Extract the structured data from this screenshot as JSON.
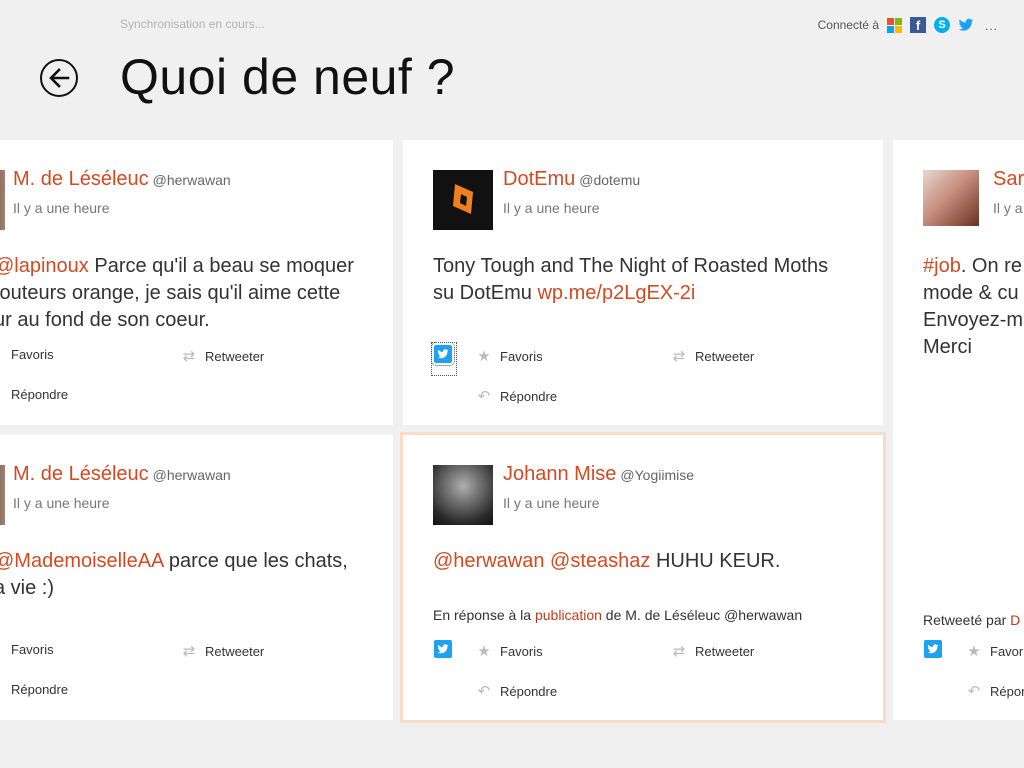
{
  "topbar": {
    "sync_status": "Synchronisation en cours...",
    "connected_label": "Connecté à",
    "services": [
      "microsoft-icon",
      "facebook-icon",
      "skype-icon",
      "twitter-icon"
    ],
    "more": "..."
  },
  "page": {
    "title": "Quoi de neuf ?"
  },
  "actions": {
    "fav": "Favoris",
    "retweet": "Retweeter",
    "reply": "Répondre"
  },
  "colors": {
    "accent": "#d34a22",
    "twitter": "#1da1f2",
    "highlight_border": "#f8dcc4",
    "background": "#f0f0f0"
  },
  "tweets": {
    "t1": {
      "name": "M. de Léséleuc",
      "handle": "@herwawan",
      "time": "Il y a une heure",
      "mention": "@lapinoux",
      "text_a": " Parce qu'il a beau se moquer",
      "line2": "touteurs orange, je sais qu'il aime cette",
      "line3": "ur au fond de son coeur."
    },
    "t2": {
      "name": "DotEmu",
      "handle": "@dotemu",
      "time": "Il y a une heure",
      "line1": "Tony Tough and The Night of Roasted Moths",
      "line2_text": "su DotEmu ",
      "link": "wp.me/p2LgEX-2i"
    },
    "t3": {
      "name": "Sara",
      "time": "Il y a",
      "hashtag": "#job",
      "line1_rest": ". On re",
      "line2": "mode & cu",
      "line3": "Envoyez-m",
      "line4": "Merci",
      "retweeted_by": "Retweeté par",
      "retweeter": "D"
    },
    "t4": {
      "name": "M. de Léséleuc",
      "handle": "@herwawan",
      "time": "Il y a une heure",
      "mention": "@MademoiselleAA",
      "text_a": " parce que les chats,",
      "line2": "a vie :)"
    },
    "t5": {
      "name": "Johann Mise",
      "handle": "@Yogiimise",
      "time": "Il y a une heure",
      "mention1": "@herwawan",
      "mention2": "@steashaz",
      "text": " HUHU KEUR.",
      "reply_prefix": "En réponse à la",
      "reply_link": "publication",
      "reply_suffix": "de M. de Léséleuc @herwawan"
    }
  }
}
